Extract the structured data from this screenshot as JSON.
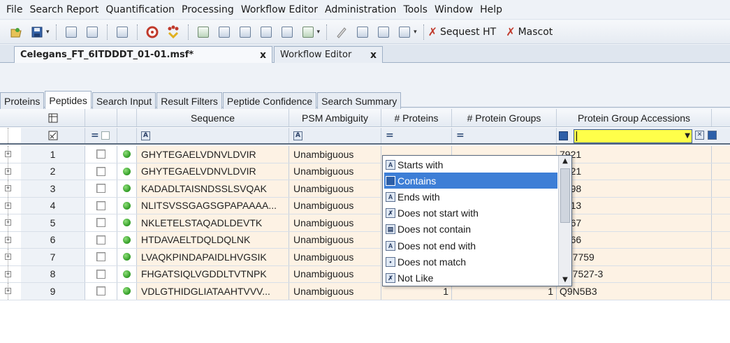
{
  "menu": [
    "File",
    "Search Report",
    "Quantification",
    "Processing",
    "Workflow Editor",
    "Administration",
    "Tools",
    "Window",
    "Help"
  ],
  "toolbar": {
    "sequest_label": "Sequest HT",
    "mascot_label": "Mascot"
  },
  "doc_tabs": {
    "active": "Celegans_FT_6ITDDDT_01-01.msf*",
    "inactive": "Workflow Editor",
    "close": "x"
  },
  "sub_tabs": [
    "Proteins",
    "Peptides",
    "Search Input",
    "Result Filters",
    "Peptide Confidence",
    "Search Summary"
  ],
  "columns": {
    "sequence": "Sequence",
    "psm_ambiguity": "PSM Ambiguity",
    "num_proteins": "# Proteins",
    "num_protein_groups": "# Protein Groups",
    "protein_group_accessions": "Protein Group Accessions"
  },
  "filter_row": {
    "eq1": "=",
    "eq2": "=",
    "eq3": "=",
    "ab_icon": "A"
  },
  "rows": [
    {
      "n": "1",
      "seq": "GHYTEGAELVDNVLDVIR",
      "amb": "Unambiguous",
      "prot": "",
      "groups": "",
      "acc": "7921"
    },
    {
      "n": "2",
      "seq": "GHYTEGAELVDNVLDVIR",
      "amb": "Unambiguous",
      "prot": "",
      "groups": "",
      "acc": "7921"
    },
    {
      "n": "3",
      "seq": "KADADLTAISNDSSLSVQAK",
      "amb": "Unambiguous",
      "prot": "",
      "groups": "",
      "acc": "7698"
    },
    {
      "n": "4",
      "seq": "NLITSVSSGAGSGPAPAAAA...",
      "amb": "Unambiguous",
      "prot": "",
      "groups": "",
      "acc": "1913"
    },
    {
      "n": "5",
      "seq": "NKLETELSTAQADLDEVTK",
      "amb": "Unambiguous",
      "prot": "",
      "groups": "",
      "acc": "0567"
    },
    {
      "n": "6",
      "seq": "HTDAVAELTDQLDQLNK",
      "amb": "Unambiguous",
      "prot": "",
      "groups": "",
      "acc": "2566"
    },
    {
      "n": "7",
      "seq": "LVAQKPINDAPAIDLHVGSIK",
      "amb": "Unambiguous",
      "prot": "1",
      "groups": "1",
      "acc": "O17759"
    },
    {
      "n": "8",
      "seq": "FHGATSIQLVGDDLTVTNPK",
      "amb": "Unambiguous",
      "prot": "2",
      "groups": "1",
      "acc": "Q27527-3"
    },
    {
      "n": "9",
      "seq": "VDLGTHIDGLIATAAHTVVV...",
      "amb": "Unambiguous",
      "prot": "1",
      "groups": "1",
      "acc": "Q9N5B3"
    }
  ],
  "dropdown": {
    "options": [
      "Starts with",
      "Contains",
      "Ends with",
      "Does not start with",
      "Does not contain",
      "Does not end with",
      "Does not match",
      "Not Like"
    ],
    "selected": "Contains"
  },
  "colors": {
    "row_bg": "#fdf2e4",
    "filter_active": "#ffff4a",
    "selection": "#3d7ed6",
    "status_green": "#2f9a24"
  }
}
